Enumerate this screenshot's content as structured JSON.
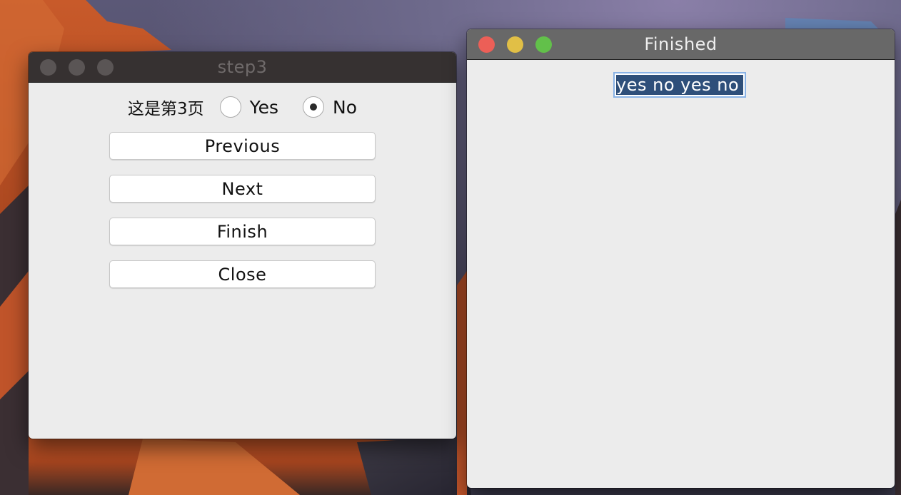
{
  "window_step3": {
    "title": "step3",
    "page_label": "这是第3页",
    "radio_options": [
      {
        "label": "Yes",
        "selected": false
      },
      {
        "label": "No",
        "selected": true
      }
    ],
    "buttons": {
      "previous": "Previous",
      "next": "Next",
      "finish": "Finish",
      "close": "Close"
    }
  },
  "window_finished": {
    "title": "Finished",
    "result_text": "yes no yes no"
  },
  "colors": {
    "close_light": "#ec5f57",
    "minimize_light": "#e1bf46",
    "zoom_light": "#62c04a",
    "selection": "#2e4f7a",
    "focus_ring": "#8ab3e6"
  }
}
